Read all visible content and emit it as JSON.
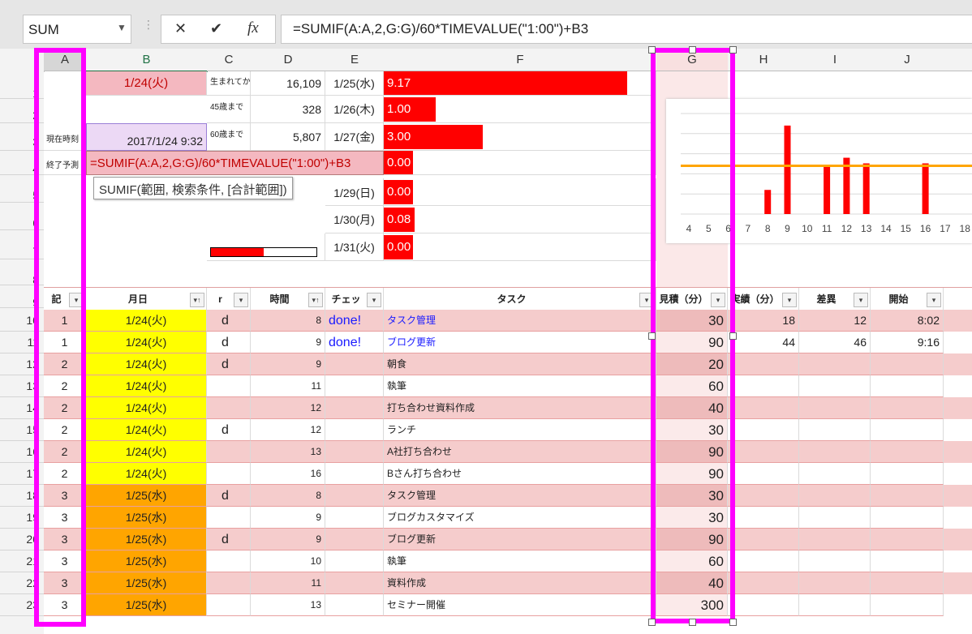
{
  "formula_bar": {
    "name_box": "SUM",
    "cancel_icon": "✕",
    "enter_icon": "✔",
    "fx_label": "fx",
    "formula": "=SUMIF(A:A,2,G:G)/60*TIMEVALUE(\"1:00\")+B3"
  },
  "columns": [
    "A",
    "B",
    "C",
    "D",
    "E",
    "F",
    "G",
    "H",
    "I",
    "J"
  ],
  "rows_visible": [
    "1",
    "2",
    "3",
    "4",
    "5",
    "6",
    "7",
    "8",
    "9",
    "10",
    "11",
    "12",
    "13",
    "14",
    "15",
    "16",
    "17",
    "18",
    "19",
    "20",
    "21",
    "22",
    "23"
  ],
  "top": {
    "b1": "1/24(火)",
    "c1": "生まれてから",
    "d1": "16,109",
    "e1": "1/25(水)",
    "f1": "9.17",
    "c2": "45歳まで",
    "d2": "328",
    "e2": "1/26(木)",
    "f2": "1.00",
    "a3": "現在時刻",
    "b3": "2017/1/24 9:32",
    "c3": "60歳まで",
    "d3": "5,807",
    "e3": "1/27(金)",
    "f3": "3.00",
    "a4": "終了予測",
    "edit_formula": "=SUMIF(A:A,2,G:G)/60*TIMEVALUE(\"1:00\")+B3",
    "f4": "0.00",
    "tooltip": "SUMIF(範囲, 検索条件, [合計範囲])",
    "e5": "1/29(日)",
    "f5": "0.00",
    "e6": "1/30(月)",
    "f6": "0.08",
    "e7": "1/31(火)",
    "f7": "0.00",
    "progress": 0.5
  },
  "table": {
    "headers": [
      "記",
      "月日",
      "r",
      "時間",
      "チェッ",
      "タスク",
      "見積（分）",
      "実績（分）",
      "差異",
      "開始"
    ],
    "rows": [
      [
        "1",
        "1/24(火)",
        "d",
        "8",
        "done!",
        "タスク管理",
        "30",
        "18",
        "12",
        "8:02"
      ],
      [
        "1",
        "1/24(火)",
        "d",
        "9",
        "done!",
        "ブログ更新",
        "90",
        "44",
        "46",
        "9:16"
      ],
      [
        "2",
        "1/24(火)",
        "d",
        "9",
        "",
        "朝食",
        "20",
        "",
        "",
        ""
      ],
      [
        "2",
        "1/24(火)",
        "",
        "11",
        "",
        "執筆",
        "60",
        "",
        "",
        ""
      ],
      [
        "2",
        "1/24(火)",
        "",
        "12",
        "",
        "打ち合わせ資料作成",
        "40",
        "",
        "",
        ""
      ],
      [
        "2",
        "1/24(火)",
        "d",
        "12",
        "",
        "ランチ",
        "30",
        "",
        "",
        ""
      ],
      [
        "2",
        "1/24(火)",
        "",
        "13",
        "",
        "A社打ち合わせ",
        "90",
        "",
        "",
        ""
      ],
      [
        "2",
        "1/24(火)",
        "",
        "16",
        "",
        "Bさん打ち合わせ",
        "90",
        "",
        "",
        ""
      ],
      [
        "3",
        "1/25(水)",
        "d",
        "8",
        "",
        "タスク管理",
        "30",
        "",
        "",
        ""
      ],
      [
        "3",
        "1/25(水)",
        "",
        "9",
        "",
        "ブログカスタマイズ",
        "30",
        "",
        "",
        ""
      ],
      [
        "3",
        "1/25(水)",
        "d",
        "9",
        "",
        "ブログ更新",
        "90",
        "",
        "",
        ""
      ],
      [
        "3",
        "1/25(水)",
        "",
        "10",
        "",
        "執筆",
        "60",
        "",
        "",
        ""
      ],
      [
        "3",
        "1/25(水)",
        "",
        "11",
        "",
        "資料作成",
        "40",
        "",
        "",
        ""
      ],
      [
        "3",
        "1/25(水)",
        "",
        "13",
        "",
        "セミナー開催",
        "300",
        "",
        "",
        ""
      ]
    ]
  },
  "chart_data": {
    "type": "bar",
    "categories": [
      "4",
      "5",
      "6",
      "7",
      "8",
      "9",
      "10",
      "11",
      "12",
      "13",
      "14",
      "15",
      "16",
      "17",
      "18"
    ],
    "values": [
      0,
      0,
      0,
      0,
      30,
      110,
      0,
      60,
      70,
      63,
      0,
      0,
      63,
      0,
      0
    ],
    "line_value": 60,
    "ylim": [
      0,
      125
    ],
    "bar_color": "#ff0000",
    "line_color": "#ffa500"
  },
  "colors": {
    "magenta": "#ff00ff",
    "red": "#ff0000",
    "yellow": "#ffff00",
    "orange": "#ffa500",
    "pink": "#f5cccc"
  }
}
